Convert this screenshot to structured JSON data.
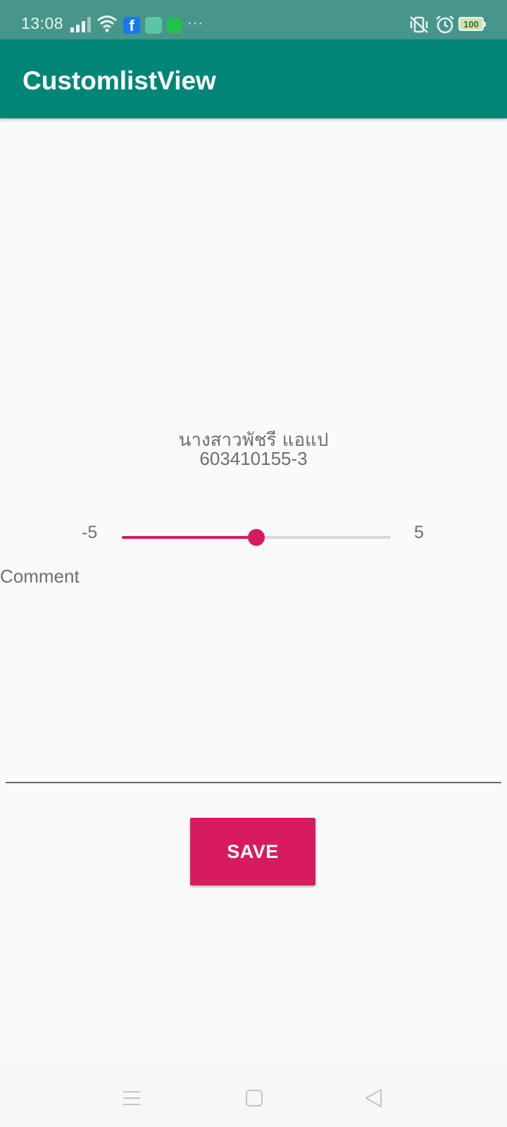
{
  "status_bar": {
    "time": "13:08",
    "battery": "100",
    "icons": [
      "signal-icon",
      "wifi-icon",
      "facebook-icon",
      "app-notification-icon",
      "line-icon",
      "more-notifications-icon",
      "vibrate-icon",
      "alarm-icon",
      "battery-icon"
    ]
  },
  "app_bar": {
    "title": "CustomlistView",
    "color": "#008577"
  },
  "person": {
    "name": "นางสาวพัชรี แอแป",
    "id": "603410155-3"
  },
  "rating": {
    "min_label": "-5",
    "max_label": "5",
    "min": -5,
    "max": 5,
    "value": 0,
    "accent": "#d81b60"
  },
  "comment": {
    "label": "Comment",
    "value": ""
  },
  "save_button": {
    "label": "SAVE",
    "color": "#d81b60"
  },
  "nav_bar": {
    "icons": [
      "menu-icon",
      "home-icon",
      "back-icon"
    ]
  }
}
